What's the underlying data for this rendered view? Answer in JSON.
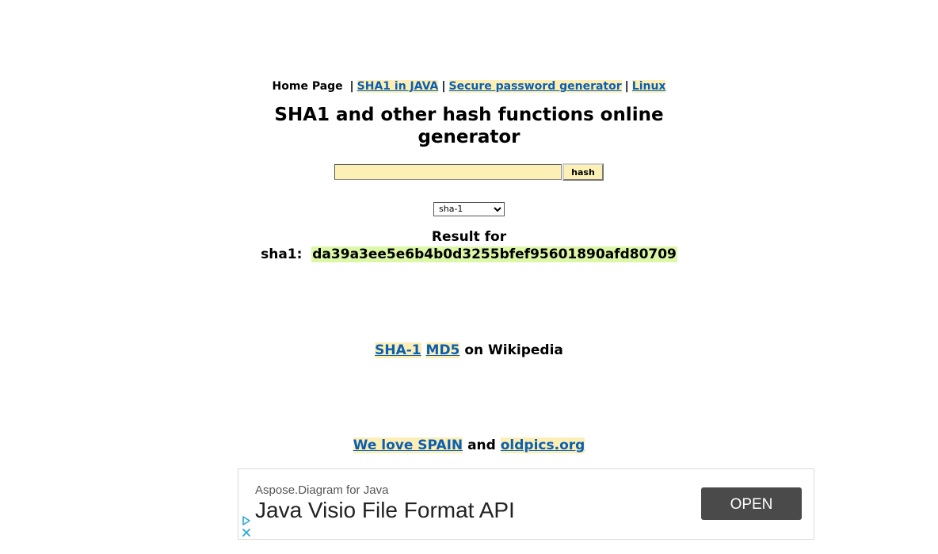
{
  "nav": {
    "home": "Home Page",
    "sep1": "|",
    "link1": "SHA1 in JAVA",
    "sep2": "|",
    "link2": "Secure password generator",
    "sep3": "|",
    "link3": "Linux"
  },
  "title": "SHA1 and other hash functions online generator",
  "form": {
    "input_value": "",
    "button_label": "hash",
    "algorithm_selected": "sha-1"
  },
  "result": {
    "label": "Result for",
    "algo_prefix": "sha1:",
    "hash": "da39a3ee5e6b4b0d3255bfef95601890afd80709"
  },
  "wiki": {
    "link1": "SHA-1",
    "link2": "MD5",
    "suffix": "on Wikipedia"
  },
  "footer": {
    "link1": "We love SPAIN",
    "joiner": "and",
    "link2": "oldpics.org"
  },
  "ad": {
    "advertiser": "Aspose.Diagram for Java",
    "headline": "Java Visio File Format API",
    "cta": "OPEN",
    "icons": [
      "adchoices-play-icon",
      "close-icon"
    ],
    "colors": {
      "cta_bg": "#4a4a4a",
      "icon": "#2aa8d8"
    }
  },
  "colors": {
    "link": "#0a5fb4",
    "link_highlight": "#fdeeb5",
    "input_bg": "#fcf0b5",
    "hash_highlight": "#ddf7a8"
  }
}
